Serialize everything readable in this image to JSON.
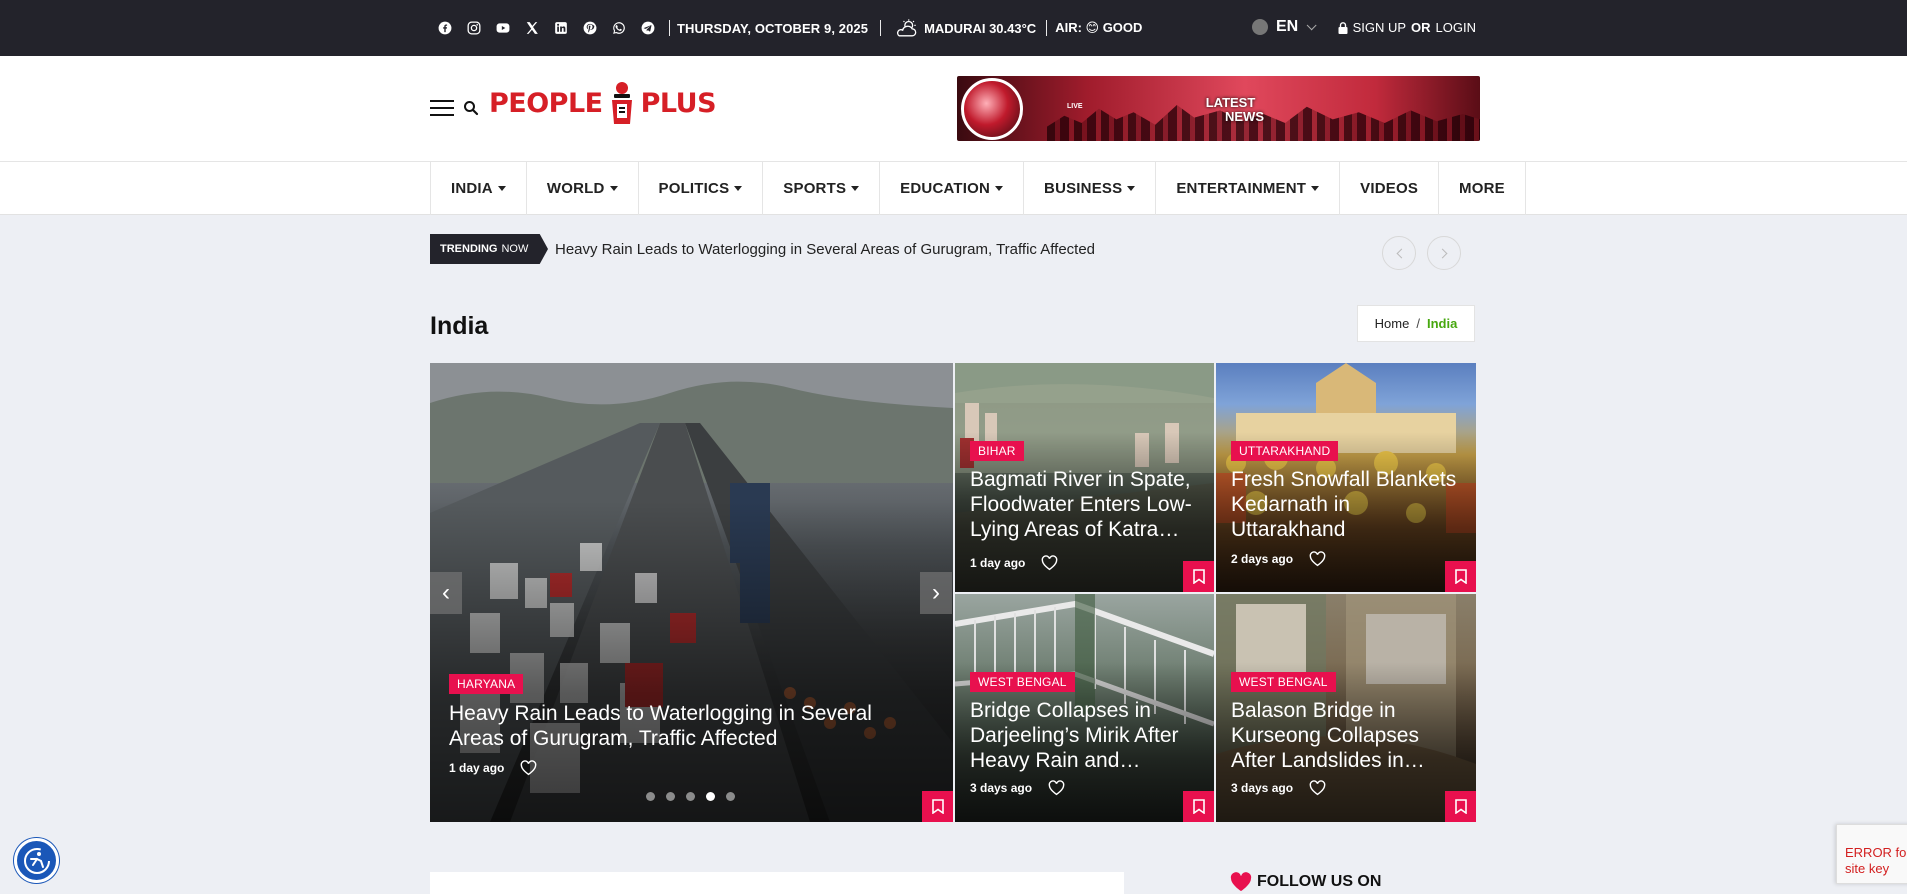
{
  "topbar": {
    "social_icons": [
      "facebook-icon",
      "instagram-icon",
      "youtube-icon",
      "x-icon",
      "linkedin-icon",
      "pinterest-icon",
      "whatsapp-icon",
      "telegram-icon"
    ],
    "date": "THURSDAY, OCTOBER 9, 2025",
    "weather": "MADURAI 30.43°C",
    "air": "AIR: 😊 GOOD",
    "language": "EN",
    "signup": "SIGN UP",
    "or": "OR",
    "login": "LOGIN"
  },
  "header": {
    "logo_left": "PEOPLE",
    "logo_right": "PLUS",
    "banner_line1": "LATEST",
    "banner_line2": "NEWS",
    "banner_live": "LIVE"
  },
  "nav": [
    {
      "label": "INDIA",
      "dropdown": true
    },
    {
      "label": "WORLD",
      "dropdown": true
    },
    {
      "label": "POLITICS",
      "dropdown": true
    },
    {
      "label": "SPORTS",
      "dropdown": true
    },
    {
      "label": "EDUCATION",
      "dropdown": true
    },
    {
      "label": "BUSINESS",
      "dropdown": true
    },
    {
      "label": "ENTERTAINMENT",
      "dropdown": true
    },
    {
      "label": "VIDEOS",
      "dropdown": false
    },
    {
      "label": "MORE",
      "dropdown": false
    }
  ],
  "trending": {
    "tag_bold": "TRENDING",
    "tag_rest": "NOW",
    "headline": "Heavy Rain Leads to Waterlogging in Several Areas of Gurugram, Traffic Affected"
  },
  "section": {
    "title": "India",
    "breadcrumb_home": "Home",
    "breadcrumb_sep": "/",
    "breadcrumb_current": "India"
  },
  "slider": {
    "tag": "HARYANA",
    "title_line1": "Heavy Rain Leads to Waterlogging in Several",
    "title_line2": "Areas of Gurugram, Traffic Affected",
    "time": "1 day ago",
    "prev": "‹",
    "next": "›",
    "slide_count": 5,
    "active_slide": 4
  },
  "cards": [
    {
      "tag": "BIHAR",
      "title": "Bagmati River in Spate, Floodwater Enters Low-Lying Areas of Katra…",
      "time": "1 day ago"
    },
    {
      "tag": "UTTARAKHAND",
      "title": "Fresh Snowfall Blankets Kedarnath in Uttarakhand",
      "time": "2 days ago"
    },
    {
      "tag": "WEST BENGAL",
      "title": "Bridge Collapses in Darjeeling’s Mirik After Heavy Rain and…",
      "time": "3 days ago"
    },
    {
      "tag": "WEST BENGAL",
      "title": "Balason Bridge in Kurseong Collapses After Landslides in…",
      "time": "3 days ago"
    }
  ],
  "bottom": {
    "follow": "FOLLOW US ON",
    "recaptcha_error": "ERROR for site key"
  },
  "colors": {
    "accent": "#e8104e",
    "topbar_bg": "#23232b",
    "brand_red": "#d61f26",
    "breadcrumb_green": "#47a80f"
  }
}
